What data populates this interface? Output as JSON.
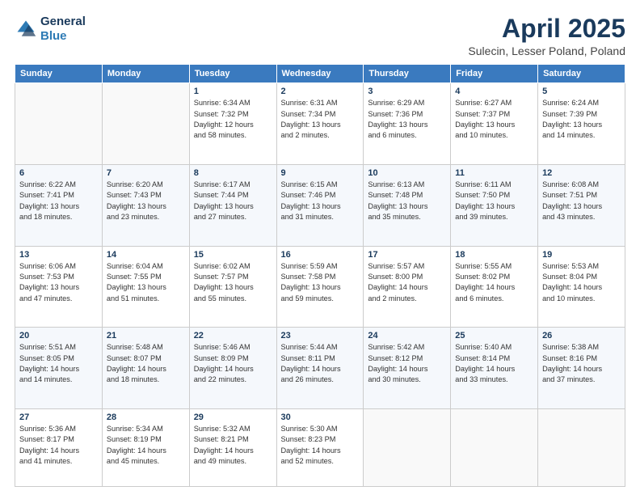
{
  "header": {
    "logo_line1": "General",
    "logo_line2": "Blue",
    "title": "April 2025",
    "subtitle": "Sulecin, Lesser Poland, Poland"
  },
  "days_of_week": [
    "Sunday",
    "Monday",
    "Tuesday",
    "Wednesday",
    "Thursday",
    "Friday",
    "Saturday"
  ],
  "weeks": [
    [
      {
        "day": "",
        "info": ""
      },
      {
        "day": "",
        "info": ""
      },
      {
        "day": "1",
        "info": "Sunrise: 6:34 AM\nSunset: 7:32 PM\nDaylight: 12 hours\nand 58 minutes."
      },
      {
        "day": "2",
        "info": "Sunrise: 6:31 AM\nSunset: 7:34 PM\nDaylight: 13 hours\nand 2 minutes."
      },
      {
        "day": "3",
        "info": "Sunrise: 6:29 AM\nSunset: 7:36 PM\nDaylight: 13 hours\nand 6 minutes."
      },
      {
        "day": "4",
        "info": "Sunrise: 6:27 AM\nSunset: 7:37 PM\nDaylight: 13 hours\nand 10 minutes."
      },
      {
        "day": "5",
        "info": "Sunrise: 6:24 AM\nSunset: 7:39 PM\nDaylight: 13 hours\nand 14 minutes."
      }
    ],
    [
      {
        "day": "6",
        "info": "Sunrise: 6:22 AM\nSunset: 7:41 PM\nDaylight: 13 hours\nand 18 minutes."
      },
      {
        "day": "7",
        "info": "Sunrise: 6:20 AM\nSunset: 7:43 PM\nDaylight: 13 hours\nand 23 minutes."
      },
      {
        "day": "8",
        "info": "Sunrise: 6:17 AM\nSunset: 7:44 PM\nDaylight: 13 hours\nand 27 minutes."
      },
      {
        "day": "9",
        "info": "Sunrise: 6:15 AM\nSunset: 7:46 PM\nDaylight: 13 hours\nand 31 minutes."
      },
      {
        "day": "10",
        "info": "Sunrise: 6:13 AM\nSunset: 7:48 PM\nDaylight: 13 hours\nand 35 minutes."
      },
      {
        "day": "11",
        "info": "Sunrise: 6:11 AM\nSunset: 7:50 PM\nDaylight: 13 hours\nand 39 minutes."
      },
      {
        "day": "12",
        "info": "Sunrise: 6:08 AM\nSunset: 7:51 PM\nDaylight: 13 hours\nand 43 minutes."
      }
    ],
    [
      {
        "day": "13",
        "info": "Sunrise: 6:06 AM\nSunset: 7:53 PM\nDaylight: 13 hours\nand 47 minutes."
      },
      {
        "day": "14",
        "info": "Sunrise: 6:04 AM\nSunset: 7:55 PM\nDaylight: 13 hours\nand 51 minutes."
      },
      {
        "day": "15",
        "info": "Sunrise: 6:02 AM\nSunset: 7:57 PM\nDaylight: 13 hours\nand 55 minutes."
      },
      {
        "day": "16",
        "info": "Sunrise: 5:59 AM\nSunset: 7:58 PM\nDaylight: 13 hours\nand 59 minutes."
      },
      {
        "day": "17",
        "info": "Sunrise: 5:57 AM\nSunset: 8:00 PM\nDaylight: 14 hours\nand 2 minutes."
      },
      {
        "day": "18",
        "info": "Sunrise: 5:55 AM\nSunset: 8:02 PM\nDaylight: 14 hours\nand 6 minutes."
      },
      {
        "day": "19",
        "info": "Sunrise: 5:53 AM\nSunset: 8:04 PM\nDaylight: 14 hours\nand 10 minutes."
      }
    ],
    [
      {
        "day": "20",
        "info": "Sunrise: 5:51 AM\nSunset: 8:05 PM\nDaylight: 14 hours\nand 14 minutes."
      },
      {
        "day": "21",
        "info": "Sunrise: 5:48 AM\nSunset: 8:07 PM\nDaylight: 14 hours\nand 18 minutes."
      },
      {
        "day": "22",
        "info": "Sunrise: 5:46 AM\nSunset: 8:09 PM\nDaylight: 14 hours\nand 22 minutes."
      },
      {
        "day": "23",
        "info": "Sunrise: 5:44 AM\nSunset: 8:11 PM\nDaylight: 14 hours\nand 26 minutes."
      },
      {
        "day": "24",
        "info": "Sunrise: 5:42 AM\nSunset: 8:12 PM\nDaylight: 14 hours\nand 30 minutes."
      },
      {
        "day": "25",
        "info": "Sunrise: 5:40 AM\nSunset: 8:14 PM\nDaylight: 14 hours\nand 33 minutes."
      },
      {
        "day": "26",
        "info": "Sunrise: 5:38 AM\nSunset: 8:16 PM\nDaylight: 14 hours\nand 37 minutes."
      }
    ],
    [
      {
        "day": "27",
        "info": "Sunrise: 5:36 AM\nSunset: 8:17 PM\nDaylight: 14 hours\nand 41 minutes."
      },
      {
        "day": "28",
        "info": "Sunrise: 5:34 AM\nSunset: 8:19 PM\nDaylight: 14 hours\nand 45 minutes."
      },
      {
        "day": "29",
        "info": "Sunrise: 5:32 AM\nSunset: 8:21 PM\nDaylight: 14 hours\nand 49 minutes."
      },
      {
        "day": "30",
        "info": "Sunrise: 5:30 AM\nSunset: 8:23 PM\nDaylight: 14 hours\nand 52 minutes."
      },
      {
        "day": "",
        "info": ""
      },
      {
        "day": "",
        "info": ""
      },
      {
        "day": "",
        "info": ""
      }
    ]
  ]
}
